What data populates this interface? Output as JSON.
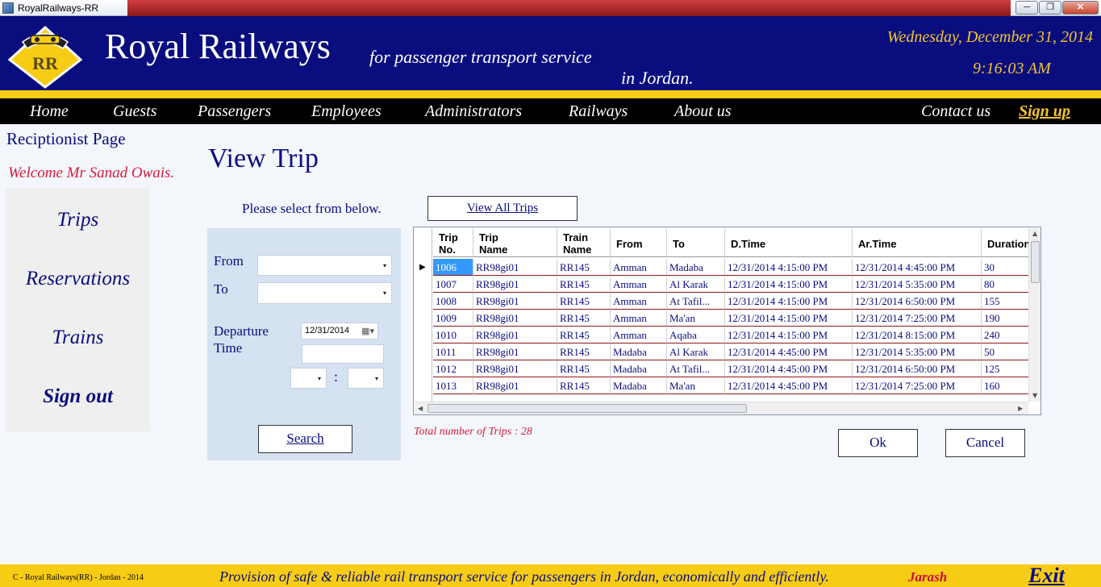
{
  "window": {
    "title": "RoyalRailways-RR",
    "min": "─",
    "max": "❐",
    "close": "✕"
  },
  "header": {
    "logo_text": "RR",
    "brand": "Royal Railways",
    "tagline_1": "for passenger transport service",
    "tagline_2": "in Jordan.",
    "date": "Wednesday, December 31, 2014",
    "time": "9:16:03 AM"
  },
  "nav": {
    "home": "Home",
    "guests": "Guests",
    "passengers": "Passengers",
    "employees": "Employees",
    "administrators": "Administrators",
    "railways": "Railways",
    "about": "About us",
    "contact": "Contact us",
    "signup": "Sign up"
  },
  "sidebar": {
    "page_label": "Reciptionist Page",
    "welcome": "Welcome Mr Sanad Owais.",
    "items": [
      "Trips",
      "Reservations",
      "Trains",
      "Sign out"
    ]
  },
  "main": {
    "title": "View Trip",
    "instruction": "Please select from below.",
    "view_all": "View All Trips",
    "from_label": "From",
    "to_label": "To",
    "departure_label_1": "Departure",
    "departure_label_2": "Time",
    "date_value": "12/31/2014",
    "time_separator": ":",
    "search": "Search",
    "total": "Total number of Trips : 28",
    "ok": "Ok",
    "cancel": "Cancel"
  },
  "grid": {
    "columns": [
      [
        "Trip",
        "No."
      ],
      [
        "Trip",
        "Name"
      ],
      [
        "Train",
        "Name"
      ],
      [
        "From"
      ],
      [
        "To"
      ],
      [
        "D.Time"
      ],
      [
        "Ar.Time"
      ],
      [
        "Duration"
      ]
    ],
    "rows": [
      [
        "1006",
        "RR98gi01",
        "RR145",
        "Amman",
        "Madaba",
        "12/31/2014 4:15:00 PM",
        "12/31/2014 4:45:00 PM",
        "30"
      ],
      [
        "1007",
        "RR98gi01",
        "RR145",
        "Amman",
        "Al Karak",
        "12/31/2014 4:15:00 PM",
        "12/31/2014 5:35:00 PM",
        "80"
      ],
      [
        "1008",
        "RR98gi01",
        "RR145",
        "Amman",
        "At Tafil...",
        "12/31/2014 4:15:00 PM",
        "12/31/2014 6:50:00 PM",
        "155"
      ],
      [
        "1009",
        "RR98gi01",
        "RR145",
        "Amman",
        "Ma'an",
        "12/31/2014 4:15:00 PM",
        "12/31/2014 7:25:00 PM",
        "190"
      ],
      [
        "1010",
        "RR98gi01",
        "RR145",
        "Amman",
        "Aqaba",
        "12/31/2014 4:15:00 PM",
        "12/31/2014 8:15:00 PM",
        "240"
      ],
      [
        "1011",
        "RR98gi01",
        "RR145",
        "Madaba",
        "Al Karak",
        "12/31/2014 4:45:00 PM",
        "12/31/2014 5:35:00 PM",
        "50"
      ],
      [
        "1012",
        "RR98gi01",
        "RR145",
        "Madaba",
        "At Tafil...",
        "12/31/2014 4:45:00 PM",
        "12/31/2014 6:50:00 PM",
        "125"
      ],
      [
        "1013",
        "RR98gi01",
        "RR145",
        "Madaba",
        "Ma'an",
        "12/31/2014 4:45:00 PM",
        "12/31/2014 7:25:00 PM",
        "160"
      ]
    ]
  },
  "footer": {
    "copyright": "C - Royal Railways(RR) - Jordan - 2014",
    "motto": "Provision of safe & reliable rail transport service for passengers in Jordan, economically and efficiently.",
    "city": "Jarash",
    "exit": "Exit"
  },
  "colors": {
    "navy": "#0a0d7e",
    "gold": "#f4c430",
    "yellow_band": "#f7cc15",
    "accent_red": "#d81b3c",
    "selection": "#3399ff"
  }
}
